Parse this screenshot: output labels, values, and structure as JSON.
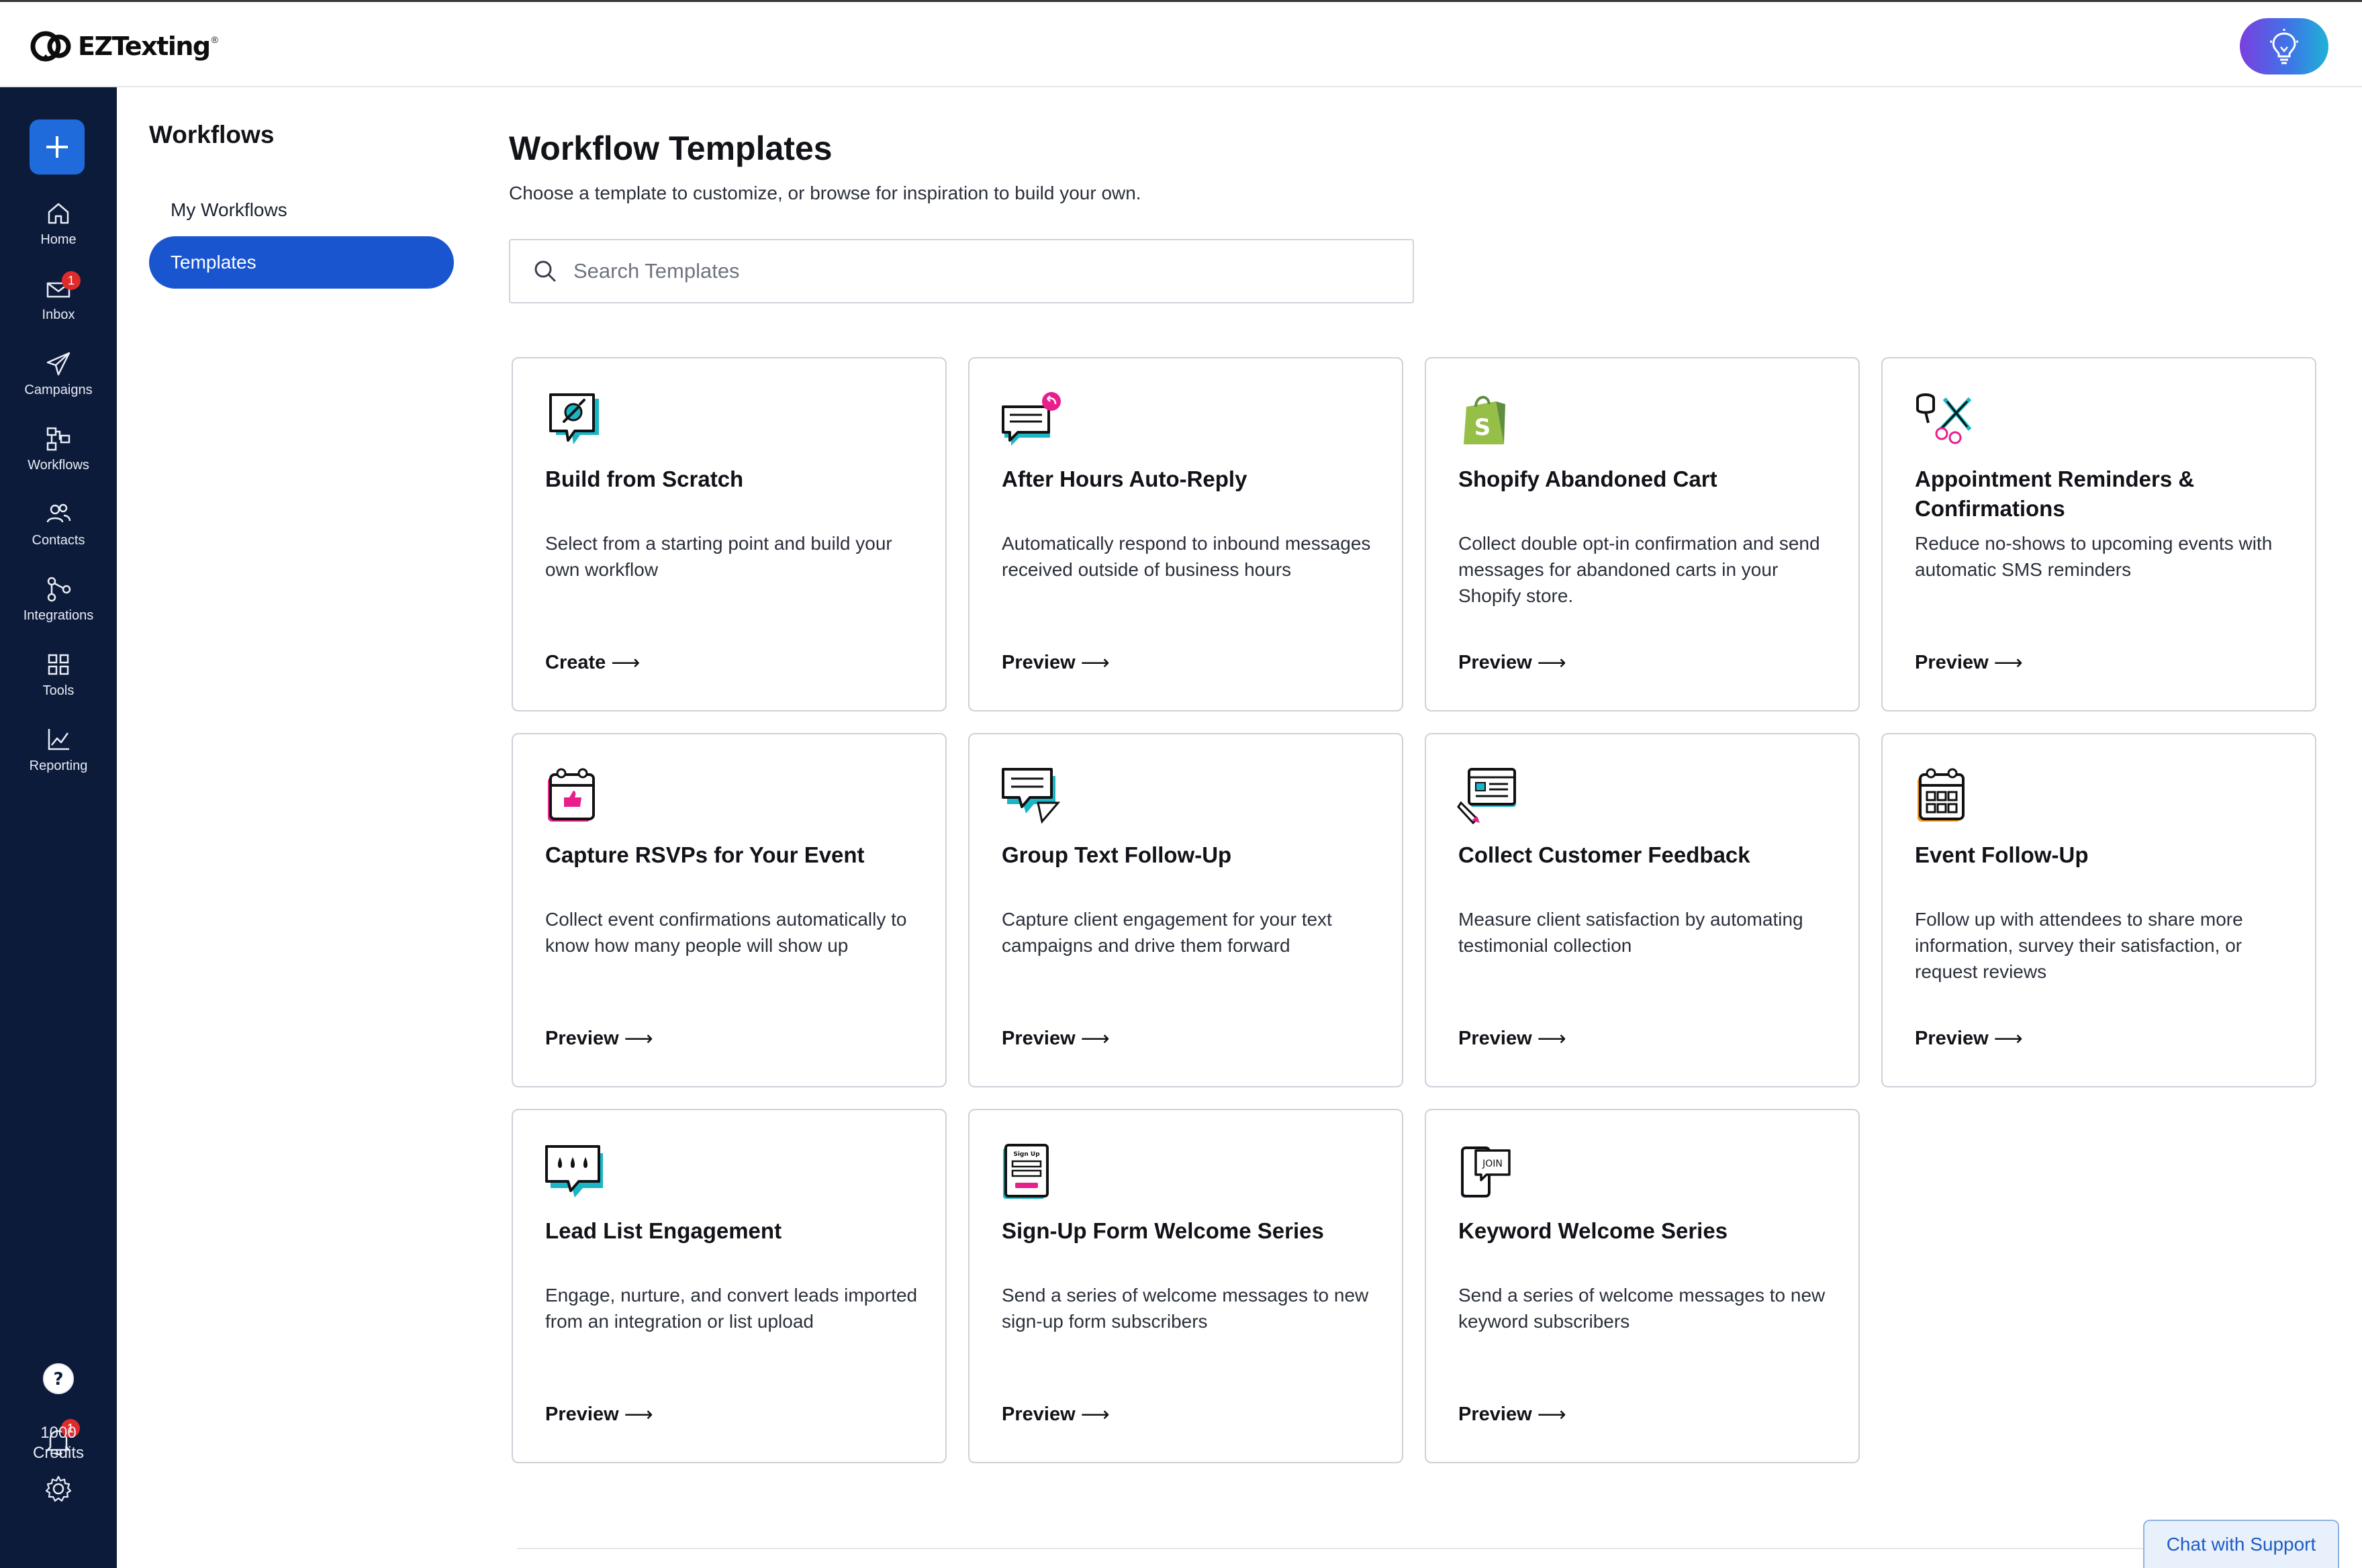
{
  "brand": {
    "name": "EZTexting",
    "registered": "®"
  },
  "rail": {
    "items": [
      {
        "label": "Home",
        "icon": "home-icon"
      },
      {
        "label": "Inbox",
        "icon": "inbox-icon",
        "badge": "1"
      },
      {
        "label": "Campaigns",
        "icon": "send-icon"
      },
      {
        "label": "Workflows",
        "icon": "workflow-icon"
      },
      {
        "label": "Contacts",
        "icon": "contacts-icon"
      },
      {
        "label": "Integrations",
        "icon": "integrations-icon"
      },
      {
        "label": "Tools",
        "icon": "grid-icon"
      },
      {
        "label": "Reporting",
        "icon": "chart-icon"
      }
    ],
    "notifications_badge": "1",
    "credits_line1": "1000",
    "credits_line2": "Credits"
  },
  "subnav": {
    "title": "Workflows",
    "items": [
      {
        "label": "My Workflows",
        "active": false
      },
      {
        "label": "Templates",
        "active": true
      }
    ]
  },
  "main": {
    "title": "Workflow Templates",
    "subtitle": "Choose a template to customize, or browse for inspiration to build your own.",
    "search_placeholder": "Search Templates",
    "cards": [
      {
        "title": "Build from Scratch",
        "description": "Select from a starting point and build your own workflow",
        "link": "Create",
        "icon": "build-icon"
      },
      {
        "title": "After Hours Auto-Reply",
        "description": "Automatically respond to inbound messages received outside of business hours",
        "link": "Preview",
        "icon": "auto-reply-icon"
      },
      {
        "title": "Shopify Abandoned Cart",
        "description": "Collect double opt-in confirmation and send messages for abandoned carts in your Shopify store.",
        "link": "Preview",
        "icon": "shopify-icon"
      },
      {
        "title": "Appointment Reminders & Confirmations",
        "description": "Reduce no-shows to upcoming events with automatic SMS reminders",
        "link": "Preview",
        "icon": "salon-icon"
      },
      {
        "title": "Capture RSVPs for Your Event",
        "description": "Collect event confirmations automatically to know how many people will show up",
        "link": "Preview",
        "icon": "rsvp-calendar-icon"
      },
      {
        "title": "Group Text Follow-Up",
        "description": "Capture client engagement for your text campaigns and drive them forward",
        "link": "Preview",
        "icon": "group-chat-icon"
      },
      {
        "title": "Collect Customer Feedback",
        "description": "Measure client satisfaction by automating testimonial collection",
        "link": "Preview",
        "icon": "feedback-icon"
      },
      {
        "title": "Event Follow-Up",
        "description": "Follow up with attendees to share more information, survey their satisfaction, or request reviews",
        "link": "Preview",
        "icon": "event-calendar-icon"
      },
      {
        "title": "Lead List Engagement",
        "description": "Engage, nurture, and convert leads imported from an integration or list upload",
        "link": "Preview",
        "icon": "typing-bubble-icon"
      },
      {
        "title": "Sign-Up Form Welcome Series",
        "description": "Send a series of welcome messages to new sign-up form subscribers",
        "link": "Preview",
        "icon": "signup-form-icon"
      },
      {
        "title": "Keyword Welcome Series",
        "description": "Send a series of welcome messages to new keyword subscribers",
        "link": "Preview",
        "icon": "keyword-join-icon"
      }
    ],
    "signup_icon_text": "Sign Up",
    "keyword_icon_text": "JOIN"
  },
  "chat": {
    "label": "Chat with Support"
  },
  "colors": {
    "rail_bg": "#0d1b3a",
    "accent": "#1a55d0",
    "teal": "#1ab6c6",
    "pink": "#e81e8c",
    "badge_red": "#e02b2b"
  }
}
